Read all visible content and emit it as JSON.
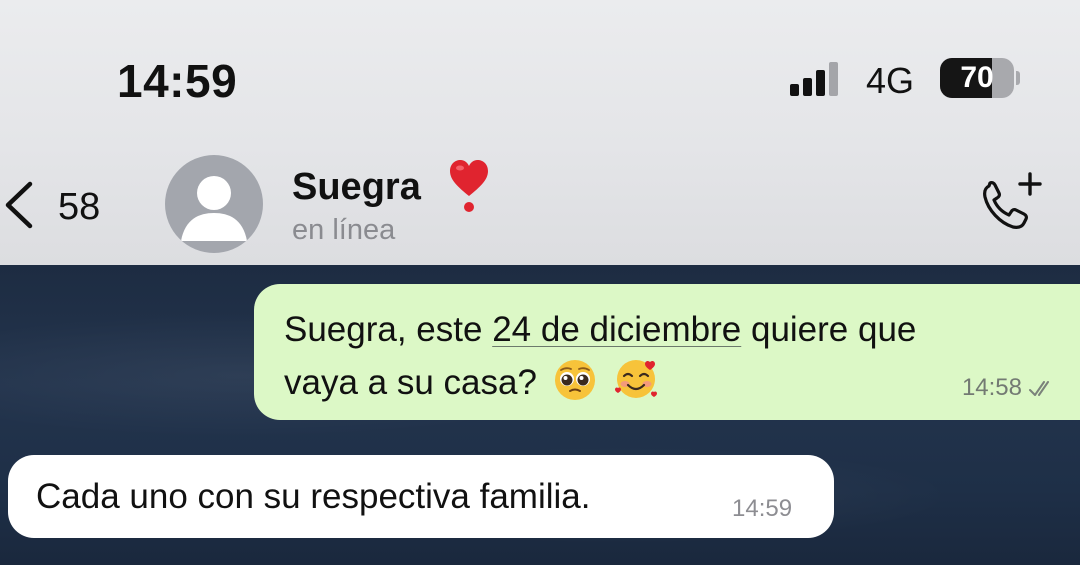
{
  "status_bar": {
    "time": "14:59",
    "network": "4G",
    "battery_percent": "70",
    "battery_level": 0.7
  },
  "header": {
    "back_count": "58",
    "contact_name": "Suegra",
    "contact_status": "en línea",
    "icons": {
      "back": "chevron-left-icon",
      "heart": "red-heart-emoji",
      "call": "phone-plus-icon",
      "avatar": "person-placeholder-icon"
    }
  },
  "messages": [
    {
      "direction": "outgoing",
      "text_before_link": "Suegra, este ",
      "link_text": "24 de diciembre",
      "text_after_link": " quiere que",
      "text_line2": "vaya a su casa?",
      "emojis": [
        "pleading-face-emoji",
        "smiling-face-with-hearts-emoji"
      ],
      "time": "14:58",
      "status": "delivered-double-check"
    },
    {
      "direction": "incoming",
      "text": "Cada uno con su respectiva familia.",
      "time": "14:59"
    }
  ],
  "colors": {
    "outgoing_bubble": "#dcf8c6",
    "incoming_bubble": "#ffffff",
    "chat_background": "#1f2f46",
    "header_background": "#e6e7ea",
    "heart": "#e0242f"
  }
}
